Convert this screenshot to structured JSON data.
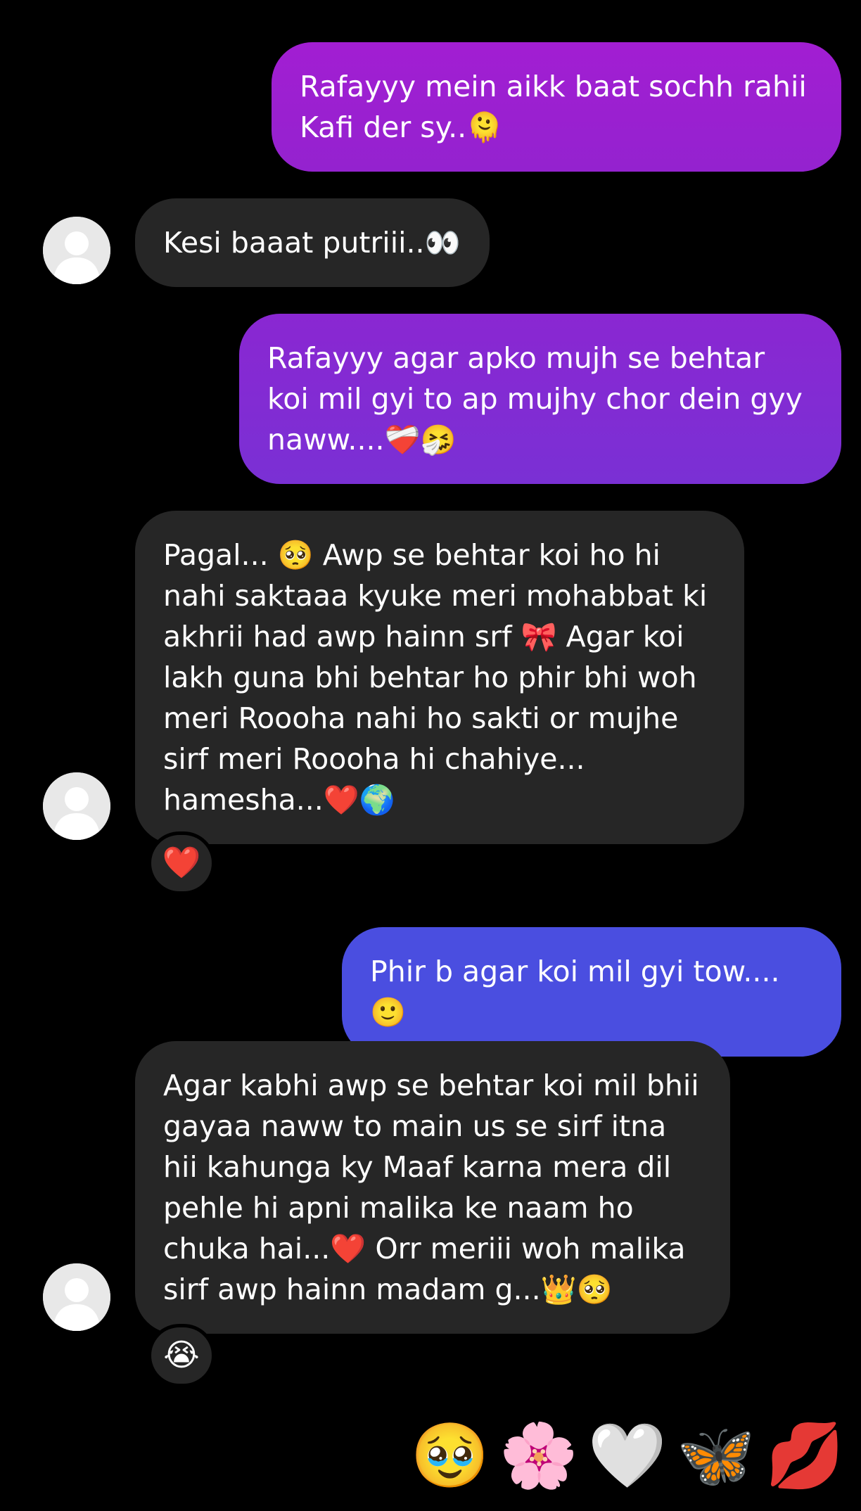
{
  "messages": [
    {
      "direction": "out",
      "text": "Rafayyy mein aikk baat sochh rahii Kafi der sy..🫠"
    },
    {
      "direction": "in",
      "text": "Kesi baaat putriii..👀"
    },
    {
      "direction": "out",
      "text": "Rafayyy agar apko mujh se behtar koi mil gyi to ap mujhy chor dein gyy naww....❤️‍🩹🤧"
    },
    {
      "direction": "in",
      "text": "Pagal... 🥺 Awp se behtar koi ho hi nahi saktaaa kyuke meri mohabbat ki akhrii had awp hainn srf 🎀 Agar koi lakh guna bhi behtar ho phir bhi woh meri Roooha nahi ho sakti or mujhe sirf meri Roooha hi chahiye... hamesha...❤️🌍",
      "reaction": "❤️"
    },
    {
      "direction": "out",
      "text": "Phir b agar koi mil gyi tow....🙂"
    },
    {
      "direction": "in",
      "text": "Agar kabhi awp se behtar koi mil bhii gayaa naww to main us se sirf itna hii kahunga ky Maaf karna mera dil pehle hi apni malika ke naam ho chuka hai...❤️ Orr meriii woh malika sirf awp hainn madam g...👑🥺",
      "reaction": "😭"
    }
  ],
  "composer_emojis": [
    "🥹",
    "🌸",
    "🤍",
    "🦋",
    "💋"
  ],
  "avatar_icon": "default-user-avatar-icon",
  "colors": {
    "background": "#000000",
    "incoming_bubble": "#262626",
    "outgoing_1": "#9a1fd0",
    "outgoing_2": "#7a2fd6",
    "outgoing_3": "#4a4fe0"
  }
}
